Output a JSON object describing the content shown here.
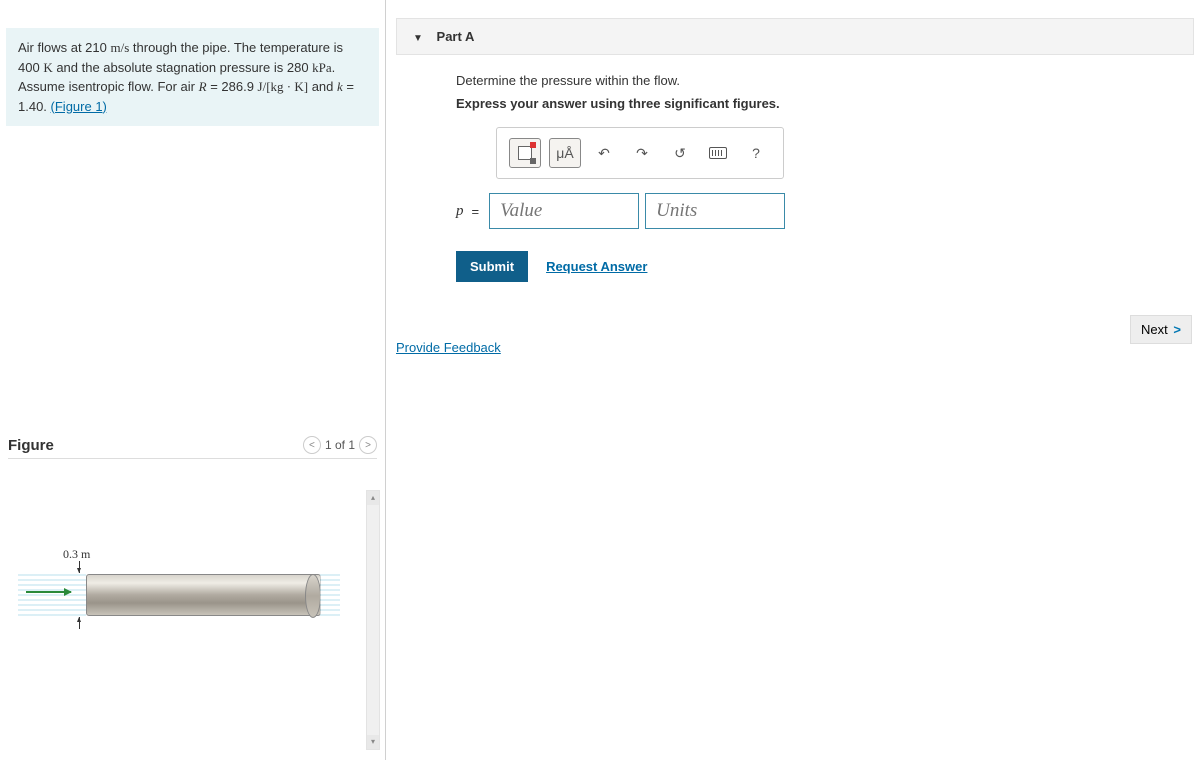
{
  "problem": {
    "text_1": "Air flows at 210 ",
    "unit_1": "m/s",
    "text_2": " through the pipe. The temperature is 400 ",
    "unit_2": "K",
    "text_3": " and the absolute stagnation pressure is 280 ",
    "unit_3": "kPa",
    "text_4": ". Assume isentropic flow. For air ",
    "var_R": "R",
    "text_5": " = 286.9 ",
    "unit_5": "J/[kg · K]",
    "text_6": " and ",
    "var_k": "k",
    "text_7": " = 1.40. ",
    "figure_link": "(Figure 1)"
  },
  "figure": {
    "title": "Figure",
    "nav_label": "1 of 1",
    "dim_label": "0.3 m"
  },
  "part": {
    "label": "Part A",
    "instruction1": "Determine the pressure within the flow.",
    "instruction2": "Express your answer using three significant figures.",
    "toolbar": {
      "micro": "μÅ",
      "undo": "↶",
      "redo": "↷",
      "reset": "↺",
      "help": "?"
    },
    "answer": {
      "var": "p",
      "equals": "=",
      "value_placeholder": "Value",
      "units_placeholder": "Units"
    },
    "submit_label": "Submit",
    "request_answer": "Request Answer"
  },
  "feedback_link": "Provide Feedback",
  "next_label": "Next"
}
